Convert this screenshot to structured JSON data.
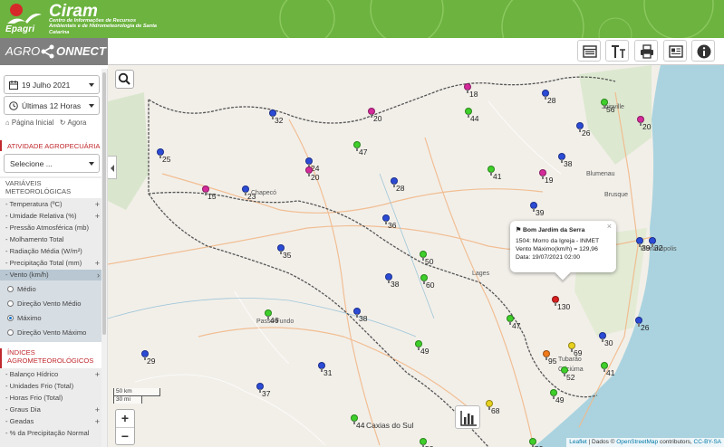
{
  "header": {
    "epagri": "Epagri",
    "ciram": "Ciram",
    "ciram_subtitle": "Centro de Informações de Recursos Ambientais e de Hidrometeorologia de Santa Catarina"
  },
  "toolbar": {
    "brand_left": "AGRO",
    "brand_right": "ONNECT",
    "buttons": [
      "list-icon",
      "text-size-icon",
      "print-icon",
      "newspaper-icon",
      "info-icon"
    ]
  },
  "sidebar": {
    "date": "19 Julho 2021",
    "period": "Últimas 12 Horas",
    "home_link": "Página Inicial",
    "now_link": "Agora",
    "atividade_title": "ATIVIDADE AGROPECUÁRIA",
    "atividade_select": "Selecione ...",
    "variaveis_title_1": "VARIÁVEIS",
    "variaveis_title_2": "METEOROLÓGICAS",
    "variables": [
      {
        "label": "- Temperatura (ºC)",
        "plus": "+"
      },
      {
        "label": "- Umidade Relativa (%)",
        "plus": "+"
      },
      {
        "label": "- Pressão Atmosférica (mb)",
        "plus": ""
      },
      {
        "label": "- Molhamento Total",
        "plus": ""
      },
      {
        "label": "- Radiação Média (W/m²)",
        "plus": ""
      },
      {
        "label": "- Precipitação Total (mm)",
        "plus": "+"
      },
      {
        "label": "- Vento (km/h)",
        "plus": "›"
      }
    ],
    "wind_options": [
      "Médio",
      "Direção Vento Médio",
      "Máximo",
      "Direção Vento Máximo"
    ],
    "indices_title_1": "ÍNDICES",
    "indices_title_2": "AGROMETEOROLÓGICOS",
    "indices": [
      {
        "label": "- Balanço Hídrico",
        "plus": "+"
      },
      {
        "label": "- Unidades Frio (Total)",
        "plus": ""
      },
      {
        "label": "- Horas Frio (Total)",
        "plus": ""
      },
      {
        "label": "- Graus Dia",
        "plus": "+"
      },
      {
        "label": "- Geadas",
        "plus": "+"
      },
      {
        "label": "- % da Precipitação Normal",
        "plus": ""
      }
    ]
  },
  "map": {
    "scale_km": "50 km",
    "scale_mi": "30 mi",
    "zoom_in": "+",
    "zoom_out": "−",
    "attribution_a": "Leaflet",
    "attribution_b": " | Dados © ",
    "attribution_c": "OpenStreetMap",
    "attribution_d": " contributors, ",
    "attribution_e": "CC-BY-SA",
    "colors": {
      "blue": "#2b4bd6",
      "green": "#3fcf2a",
      "magenta": "#d42a9a",
      "red": "#d62020",
      "yellow": "#e8d21e",
      "orange": "#f07a1a"
    },
    "place_labels": [
      "Joinville",
      "Blumenau",
      "Brusque",
      "Lages",
      "Passo Fundo",
      "Caxias do Sul",
      "Chapecó",
      "Tubarão",
      "Criciúma",
      "Florianópolis"
    ],
    "stations": [
      {
        "v": "18",
        "c": "magenta"
      },
      {
        "v": "28",
        "c": "blue"
      },
      {
        "v": "56",
        "c": "green"
      },
      {
        "v": "32",
        "c": "blue"
      },
      {
        "v": "20",
        "c": "magenta"
      },
      {
        "v": "44",
        "c": "green"
      },
      {
        "v": "20",
        "c": "magenta"
      },
      {
        "v": "26",
        "c": "blue"
      },
      {
        "v": "47",
        "c": "green"
      },
      {
        "v": "25",
        "c": "blue"
      },
      {
        "v": "24",
        "c": "blue"
      },
      {
        "v": "38",
        "c": "blue"
      },
      {
        "v": "20",
        "c": "magenta"
      },
      {
        "v": "41",
        "c": "green"
      },
      {
        "v": "19",
        "c": "magenta"
      },
      {
        "v": "23",
        "c": "blue"
      },
      {
        "v": "28",
        "c": "blue"
      },
      {
        "v": "15",
        "c": "magenta"
      },
      {
        "v": "39",
        "c": "blue"
      },
      {
        "v": "36",
        "c": "blue"
      },
      {
        "v": "35",
        "c": "blue"
      },
      {
        "v": "50",
        "c": "green"
      },
      {
        "v": "39",
        "c": "blue"
      },
      {
        "v": "32",
        "c": "blue"
      },
      {
        "v": "38",
        "c": "blue"
      },
      {
        "v": "60",
        "c": "green"
      },
      {
        "v": "130",
        "c": "red"
      },
      {
        "v": "46",
        "c": "green"
      },
      {
        "v": "38",
        "c": "blue"
      },
      {
        "v": "47",
        "c": "green"
      },
      {
        "v": "26",
        "c": "blue"
      },
      {
        "v": "49",
        "c": "green"
      },
      {
        "v": "69",
        "c": "yellow"
      },
      {
        "v": "30",
        "c": "blue"
      },
      {
        "v": "95",
        "c": "orange"
      },
      {
        "v": "29",
        "c": "blue"
      },
      {
        "v": "52",
        "c": "green"
      },
      {
        "v": "31",
        "c": "blue"
      },
      {
        "v": "41",
        "c": "green"
      },
      {
        "v": "37",
        "c": "blue"
      },
      {
        "v": "49",
        "c": "green"
      },
      {
        "v": "68",
        "c": "yellow"
      },
      {
        "v": "44",
        "c": "green"
      },
      {
        "v": "53",
        "c": "green"
      },
      {
        "v": "59",
        "c": "green"
      }
    ],
    "popup": {
      "title": "Bom Jardim da Serra",
      "line1": "1504: Morro da Igreja - INMET",
      "line2": "Vento Máximo(km/h) = 129,96",
      "line3": "Data: 19/07/2021 02:00",
      "close": "×"
    }
  }
}
